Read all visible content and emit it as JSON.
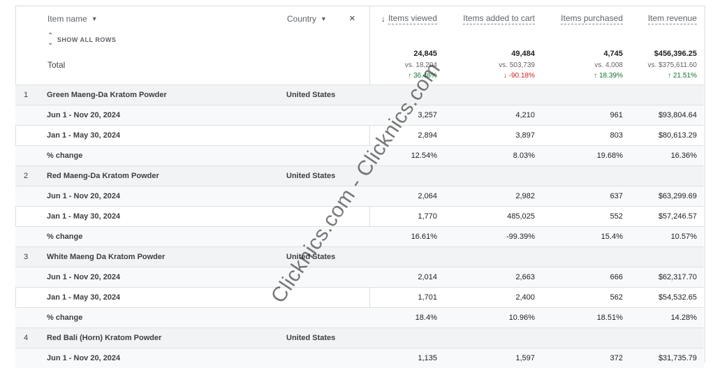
{
  "header": {
    "dim1": "Item name",
    "dim2": "Country",
    "close": "×",
    "show_all": "SHOW ALL ROWS",
    "metrics": [
      "Items viewed",
      "Items added to cart",
      "Items purchased",
      "Item revenue"
    ]
  },
  "total": {
    "label": "Total",
    "values": [
      {
        "main": "24,845",
        "vs": "vs. 18,204",
        "change": "36.48%",
        "dir": "up"
      },
      {
        "main": "49,484",
        "vs": "vs. 503,739",
        "change": "-90.18%",
        "dir": "down"
      },
      {
        "main": "4,745",
        "vs": "vs. 4,008",
        "change": "18.39%",
        "dir": "up"
      },
      {
        "main": "$456,396.25",
        "vs": "vs. $375,611.60",
        "change": "21.51%",
        "dir": "up"
      }
    ]
  },
  "items": [
    {
      "num": "1",
      "name": "Green Maeng-Da Kratom Powder",
      "country": "United States",
      "rows": [
        {
          "label": "Jun 1 - Nov 20, 2024",
          "v": [
            "3,257",
            "4,210",
            "961",
            "$93,804.64"
          ]
        },
        {
          "label": "Jan 1 - May 30, 2024",
          "v": [
            "2,894",
            "3,897",
            "803",
            "$80,613.29"
          ]
        },
        {
          "label": "% change",
          "v": [
            "12.54%",
            "8.03%",
            "19.68%",
            "16.36%"
          ]
        }
      ]
    },
    {
      "num": "2",
      "name": "Red Maeng-Da Kratom Powder",
      "country": "United States",
      "rows": [
        {
          "label": "Jun 1 - Nov 20, 2024",
          "v": [
            "2,064",
            "2,982",
            "637",
            "$63,299.69"
          ]
        },
        {
          "label": "Jan 1 - May 30, 2024",
          "v": [
            "1,770",
            "485,025",
            "552",
            "$57,246.57"
          ]
        },
        {
          "label": "% change",
          "v": [
            "16.61%",
            "-99.39%",
            "15.4%",
            "10.57%"
          ]
        }
      ]
    },
    {
      "num": "3",
      "name": "White Maeng Da Kratom Powder",
      "country": "United States",
      "rows": [
        {
          "label": "Jun 1 - Nov 20, 2024",
          "v": [
            "2,014",
            "2,663",
            "666",
            "$62,317.70"
          ]
        },
        {
          "label": "Jan 1 - May 30, 2024",
          "v": [
            "1,701",
            "2,400",
            "562",
            "$54,532.65"
          ]
        },
        {
          "label": "% change",
          "v": [
            "18.4%",
            "10.96%",
            "18.51%",
            "14.28%"
          ]
        }
      ]
    },
    {
      "num": "4",
      "name": "Red Bali (Horn) Kratom Powder",
      "country": "United States",
      "rows": [
        {
          "label": "Jun 1 - Nov 20, 2024",
          "v": [
            "1,135",
            "1,597",
            "372",
            "$31,735.79"
          ]
        }
      ]
    }
  ],
  "watermark": "Clicknics.com - Clicknics.com"
}
